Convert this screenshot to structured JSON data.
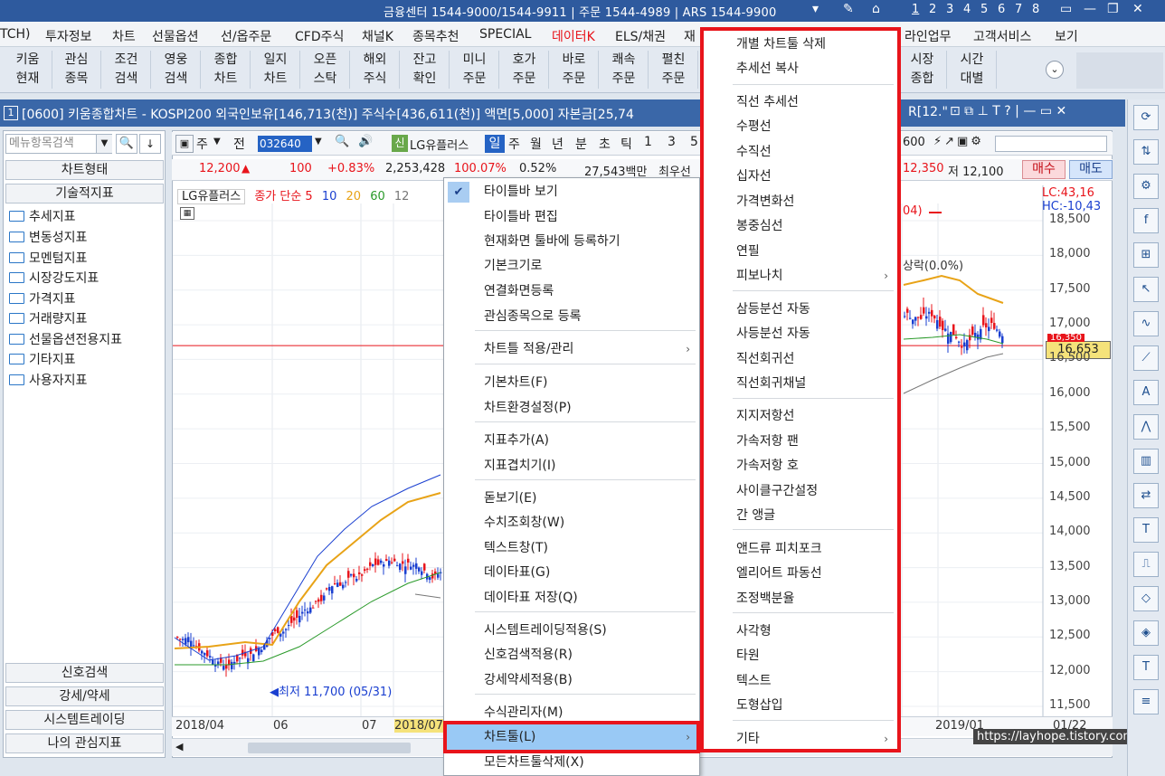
{
  "topbar": {
    "info": "금융센터 1544-9000/1544-9911 | 주문 1544-4989 | ARS 1544-9900",
    "pages": [
      "1",
      "2",
      "3",
      "4",
      "5",
      "6",
      "7",
      "8"
    ]
  },
  "menubar": [
    "TCH)",
    "투자정보",
    "차트",
    "선물옵션",
    "선/옵주문",
    "CFD주식",
    "채널K",
    "종목추천",
    "SPECIAL",
    "데이터K",
    "ELS/채권",
    "재",
    "라인업무",
    "고객서비스",
    "보기"
  ],
  "menubar_accent": "#e8141b",
  "toolbar": [
    [
      "키움",
      "현재"
    ],
    [
      "관심",
      "종목"
    ],
    [
      "조건",
      "검색"
    ],
    [
      "영웅",
      "검색"
    ],
    [
      "종합",
      "차트"
    ],
    [
      "일지",
      "차트"
    ],
    [
      "오픈",
      "스탁"
    ],
    [
      "해외",
      "주식"
    ],
    [
      "잔고",
      "확인"
    ],
    [
      "미니",
      "주문"
    ],
    [
      "호가",
      "주문"
    ],
    [
      "바로",
      "주문"
    ],
    [
      "쾌속",
      "주문"
    ],
    [
      "펼친",
      "주문"
    ],
    [
      "시장",
      "종합"
    ],
    [
      "시간",
      "대별"
    ]
  ],
  "window": {
    "number": "1",
    "title": "[0600] 키움종합차트 - KOSPI200 외국인보유[146,713(천)] 주식수[436,611(천)] 액면[5,000] 자본금[25,74",
    "title_tail": "R[12.\""
  },
  "left": {
    "search_placeholder": "메뉴항목검색",
    "chart_type": "차트형태",
    "tech": "기술적지표",
    "tree": [
      "추세지표",
      "변동성지표",
      "모멘텀지표",
      "시장강도지표",
      "가격지표",
      "거래량지표",
      "선물옵션전용지표",
      "기타지표",
      "사용자지표"
    ],
    "bottom": [
      "신호검색",
      "강세/약세",
      "시스템트레이딩",
      "나의 관심지표"
    ]
  },
  "ctrl": {
    "code": "032640",
    "name": "LG유플러스",
    "btns": [
      "주",
      "전",
      "일",
      "주",
      "월",
      "년",
      "분",
      "초",
      "틱",
      "1",
      "3",
      "5"
    ],
    "v600": "600"
  },
  "price": {
    "last": "12,200",
    "change": "100",
    "pct": "+0.83%",
    "volume": "2,253,428",
    "ratio": "100.07%",
    "r2": "0.52%",
    "amount": "27,543백만",
    "best": "최우선",
    "hi": "12,350",
    "lo": "저 12,100",
    "buy": "매수",
    "sell": "매도"
  },
  "legend": {
    "name": "LG유플러스",
    "ma": "종가 단순 5",
    "ma10": "10",
    "ma20": "20",
    "ma60": "60",
    "ma120": "12"
  },
  "chart_labels": {
    "lc": "LC:43,16",
    "hc": "HC:-10,43",
    "current": "16,653",
    "lowmark": "최저 11,700 (05/31)",
    "hint1": "04)",
    "hint2": "상락(0.0%)",
    "hint_val": "16,350"
  },
  "chart_data": {
    "type": "candlestick",
    "ylim": [
      11500,
      18750
    ],
    "yticks": [
      "18,500",
      "18,000",
      "17,500",
      "17,000",
      "16,500",
      "16,000",
      "15,500",
      "15,000",
      "14,500",
      "14,000",
      "13,500",
      "13,000",
      "12,500",
      "12,000",
      "11,500"
    ],
    "xticks": [
      "2018/04",
      "06",
      "07",
      "2018/07",
      "2019/01",
      "01/22"
    ]
  },
  "ctxmenu": [
    {
      "label": "타이틀바 보기",
      "checked": true
    },
    {
      "label": "타이틀바 편집"
    },
    {
      "label": "현재화면 툴바에 등록하기"
    },
    {
      "label": "기본크기로"
    },
    {
      "label": "연결화면등록"
    },
    {
      "label": "관심종목으로 등록"
    },
    {
      "label": "차트틀 적용/관리",
      "sub": true
    },
    {
      "label": "기본차트(F)"
    },
    {
      "label": "차트환경설정(P)"
    },
    {
      "label": "지표추가(A)"
    },
    {
      "label": "지표겹치기(I)"
    },
    {
      "label": "돋보기(E)"
    },
    {
      "label": "수치조회창(W)"
    },
    {
      "label": "텍스트창(T)"
    },
    {
      "label": "데이타표(G)"
    },
    {
      "label": "데이타표 저장(Q)"
    },
    {
      "label": "시스템트레이딩적용(S)"
    },
    {
      "label": "신호검색적용(R)"
    },
    {
      "label": "강세약세적용(B)"
    },
    {
      "label": "수식관리자(M)"
    },
    {
      "label": "차트툴(L)",
      "sub": true
    },
    {
      "label": "모든차트툴삭제(X)"
    }
  ],
  "submenu": [
    "개별 차트툴 삭제",
    "추세선 복사",
    "직선 추세선",
    "수평선",
    "수직선",
    "십자선",
    "가격변화선",
    "봉중심선",
    "연필",
    "피보나치",
    "삼등분선 자동",
    "사등분선 자동",
    "직선회귀선",
    "직선회귀채널",
    "지지저항선",
    "가속저항 팬",
    "가속저항 호",
    "사이클구간설정",
    "간 앵글",
    "앤드류 피치포크",
    "엘리어트 파동선",
    "조정백분율",
    "사각형",
    "타원",
    "텍스트",
    "도형삽입",
    "기타"
  ],
  "watermark": "https://layhope.tistory.com"
}
